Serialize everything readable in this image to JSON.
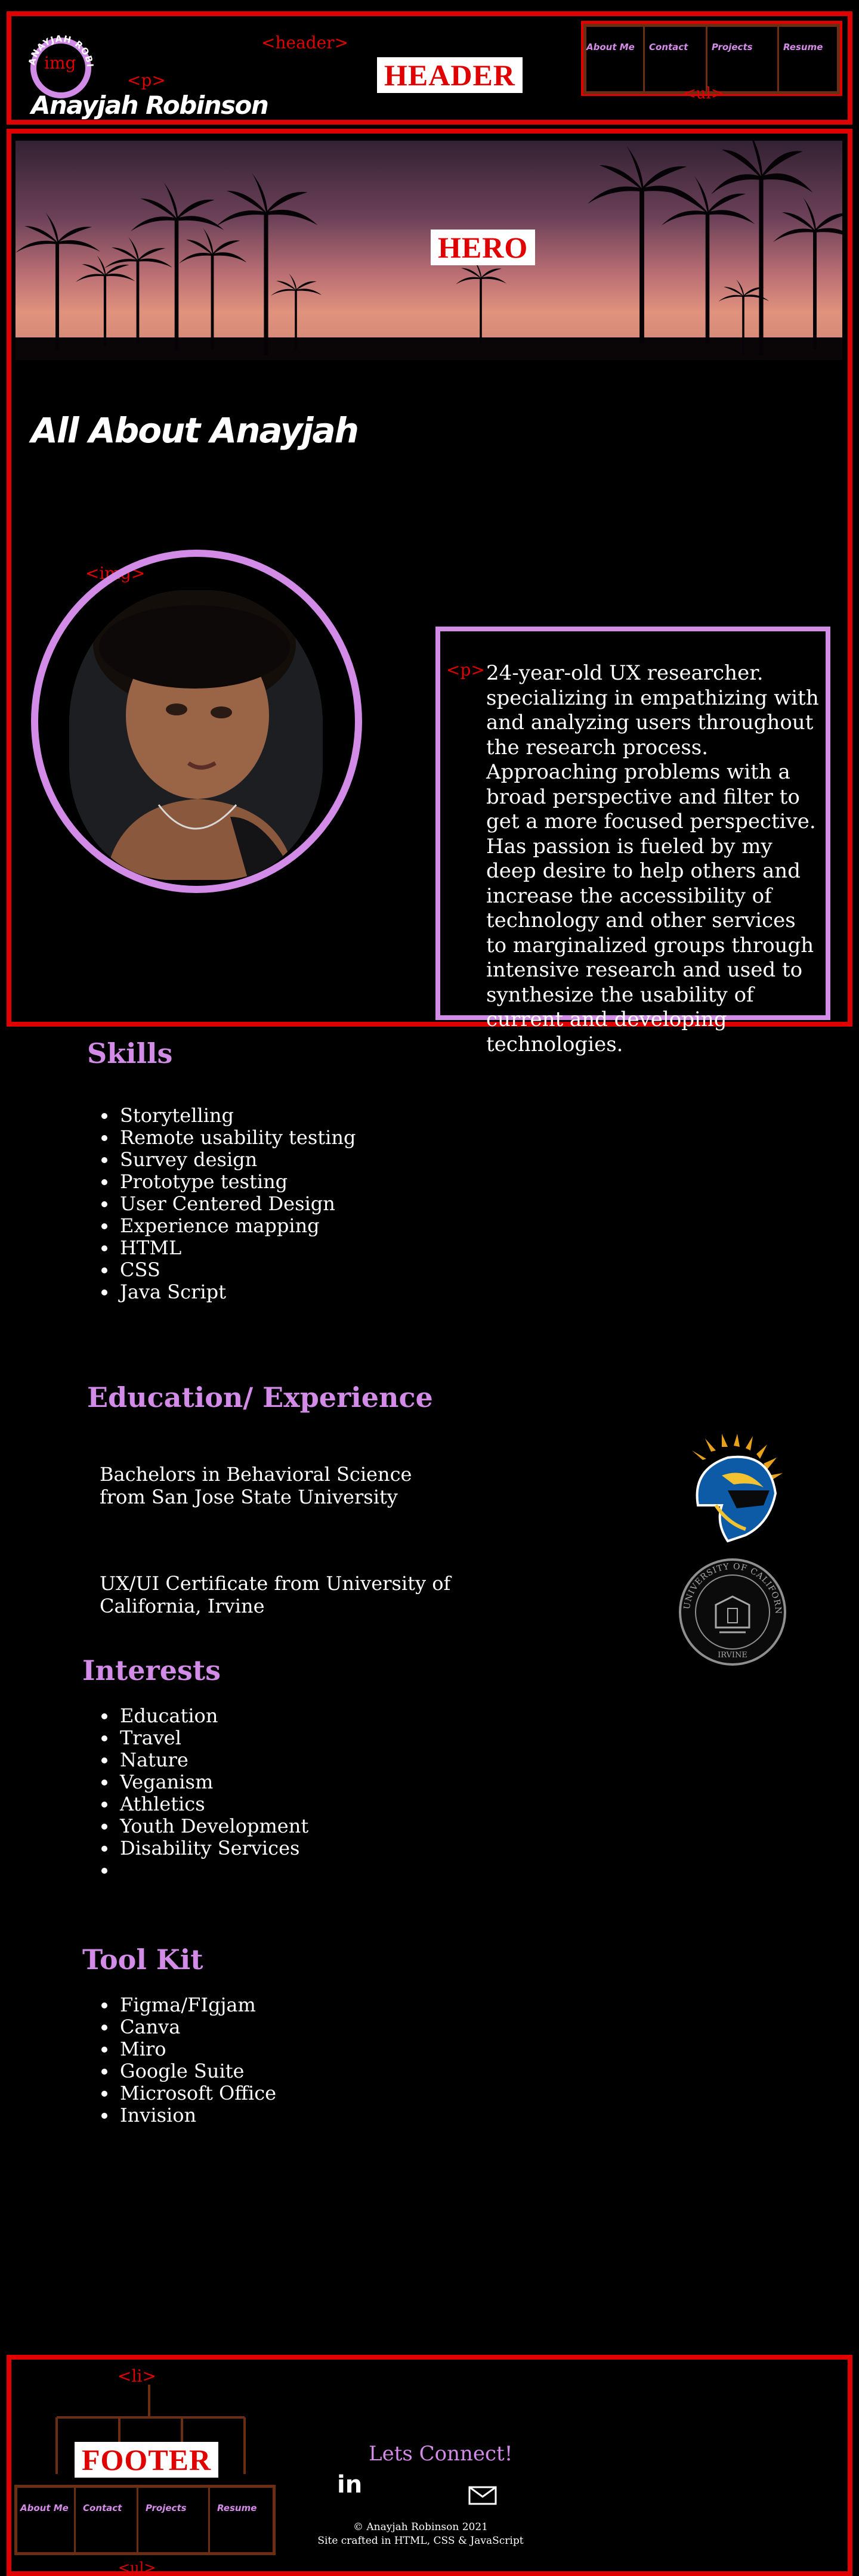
{
  "site": {
    "name": "Anayjah Robinson",
    "logo_text": "ANAYJAH ROBINSON"
  },
  "overlay_tags": {
    "header": "<header>",
    "p_header": "<p>",
    "img_logo": "img",
    "ul_header": "<ul>",
    "img_profile": "<img>",
    "p_intro": "<p>",
    "li_footer": "<li>",
    "ul_footer": "<ul>"
  },
  "region_labels": {
    "header": "HEADER",
    "hero": "HERO",
    "footer": "FOOTER"
  },
  "nav": {
    "items": [
      {
        "label": "About Me"
      },
      {
        "label": "Contact"
      },
      {
        "label": "Projects"
      },
      {
        "label": "Resume"
      }
    ]
  },
  "about": {
    "title": "All About Anayjah",
    "intro": "24-year-old UX researcher. specializing in empathizing with and analyzing users throughout the research process. Approaching problems with a broad perspective and filter to get a more focused perspective. Has passion is fueled by my deep desire to help others and increase the accessibility of technology and other services to marginalized groups through intensive research and used to synthesize the usability of current and developing technologies."
  },
  "skills": {
    "title": "Skills",
    "items": [
      "Storytelling",
      "Remote usability testing",
      "Survey design",
      "Prototype testing",
      "User Centered Design",
      "Experience mapping",
      "HTML",
      "CSS",
      "Java Script"
    ]
  },
  "education": {
    "title": "Education/ Experience",
    "items": [
      {
        "text": "Bachelors in Behavioral Science from San Jose State University",
        "logo": "sjsu-spartan-logo"
      },
      {
        "text": "UX/UI Certificate from University of California, Irvine",
        "logo": "uc-irvine-seal"
      }
    ],
    "seal_text": "UNIVERSITY OF CALIFORNIA",
    "seal_sub": "IRVINE"
  },
  "interests": {
    "title": "Interests",
    "items": [
      "Education",
      "Travel",
      "Nature",
      "Veganism",
      "Athletics",
      "Youth Development",
      "Disability Services",
      ""
    ]
  },
  "toolkit": {
    "title": "Tool Kit",
    "items": [
      "Figma/FIgjam",
      "Canva",
      "Miro",
      "Google Suite",
      "Microsoft Office",
      "Invision"
    ]
  },
  "footer": {
    "connect": "Lets Connect!",
    "linkedin_label": "in",
    "copyright": "© Anayjah Robinson 2021",
    "crafted": "Site crafted in HTML, CSS & JavaScript"
  },
  "colors": {
    "background": "#000000",
    "accent_purple": "#d38be8",
    "annotation_red": "#e00000",
    "annotation_brown": "#6b2e12"
  }
}
